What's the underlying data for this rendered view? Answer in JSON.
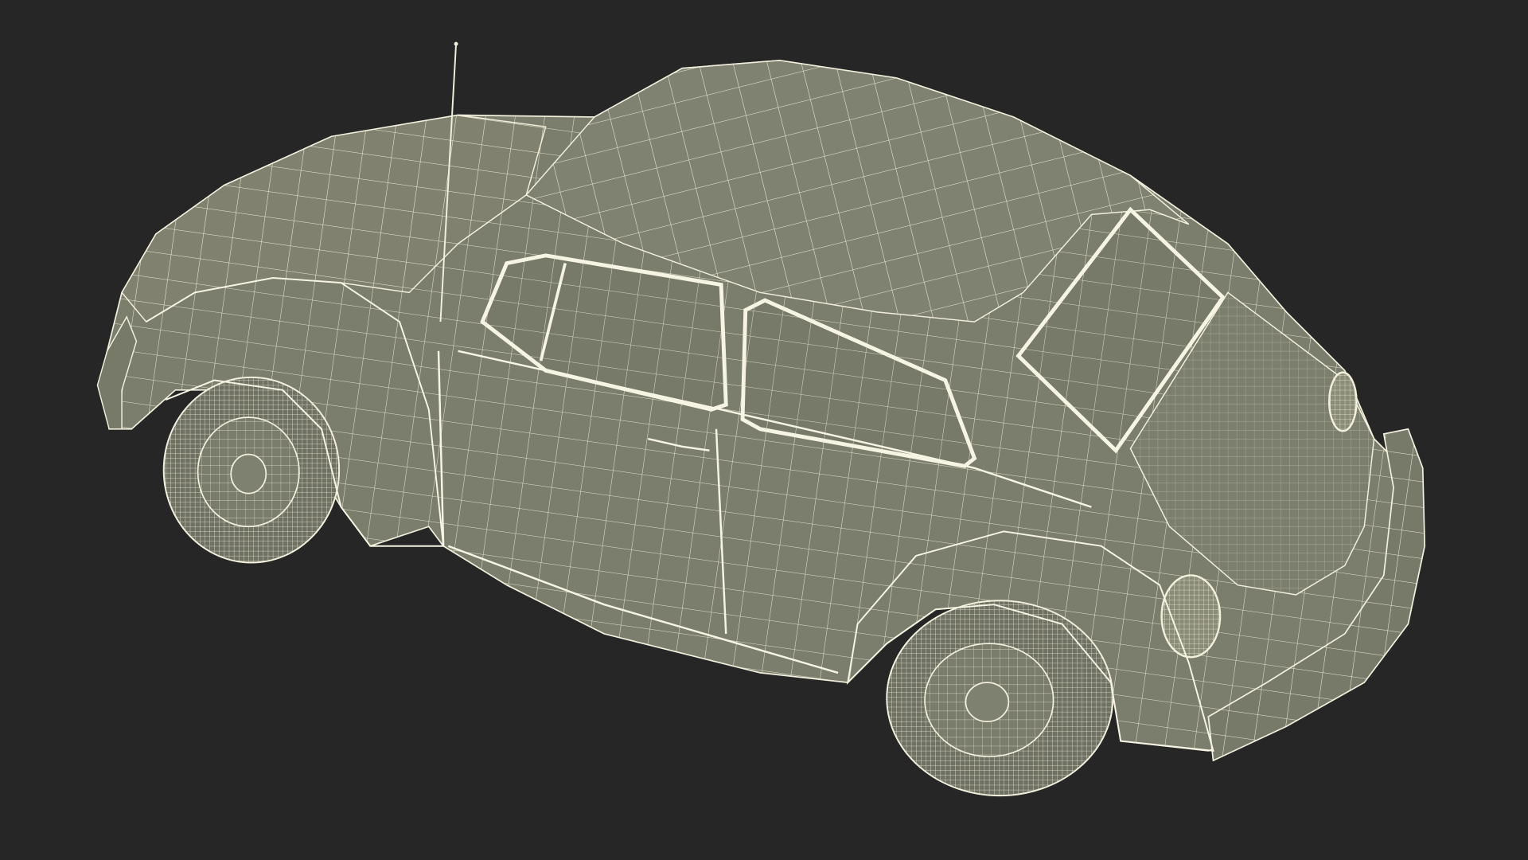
{
  "scene": {
    "background_color": "#262626",
    "mesh_fill_color": "#7b7d6d",
    "mesh_fill_shadow": "#6e7062",
    "mesh_fill_light": "#878977",
    "wire_color": "#f2f0dc",
    "subject": "car-wireframe"
  }
}
